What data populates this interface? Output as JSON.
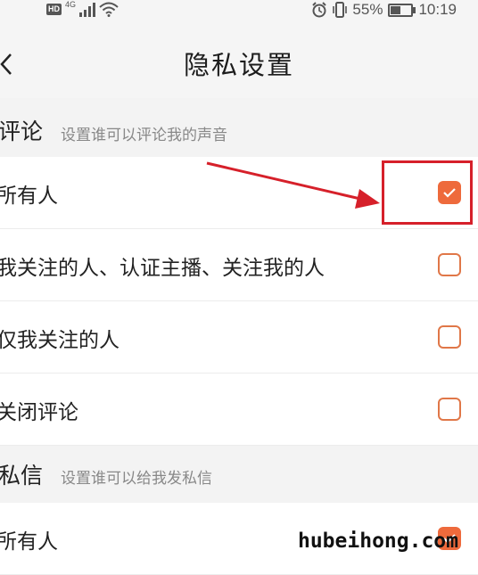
{
  "status_bar": {
    "left_badge": "HD",
    "network": "4G",
    "battery": "55%",
    "battery_level": 0.55,
    "time": "10:19"
  },
  "nav": {
    "title": "隐私设置",
    "back_icon": "chevron-left-icon"
  },
  "sections": [
    {
      "title": "评论",
      "subtitle": "设置谁可以评论我的声音",
      "options": [
        {
          "label": "所有人",
          "checked": true
        },
        {
          "label": "我关注的人、认证主播、关注我的人",
          "checked": false
        },
        {
          "label": "仅我关注的人",
          "checked": false
        },
        {
          "label": "关闭评论",
          "checked": false
        }
      ]
    },
    {
      "title": "私信",
      "subtitle": "设置谁可以给我发私信",
      "options": [
        {
          "label": "所有人",
          "checked": true
        }
      ]
    }
  ],
  "annotation": {
    "color": "#d6202a"
  },
  "watermark": "hubeihong.com",
  "colors": {
    "accent": "#ee6a3c",
    "section_bg": "#f3f3f3"
  }
}
